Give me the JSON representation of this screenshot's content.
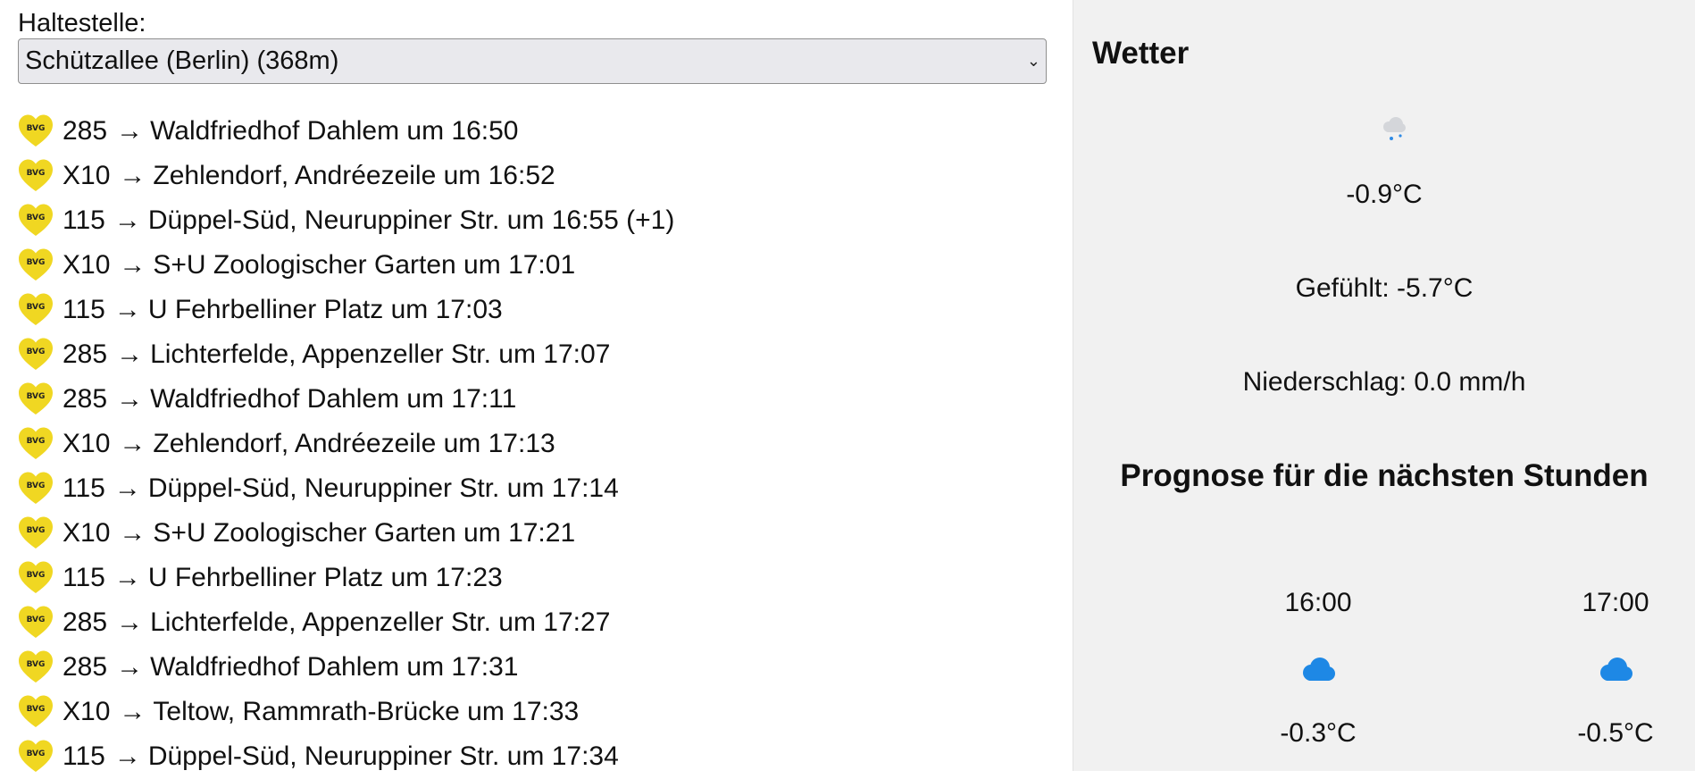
{
  "stop": {
    "label": "Haltestelle:",
    "selected": "Schützallee (Berlin) (368m)"
  },
  "departures": [
    {
      "line": "285",
      "arrow": "→",
      "text": "Waldfriedhof Dahlem um 16:50"
    },
    {
      "line": "X10",
      "arrow": "→",
      "text": "Zehlendorf, Andréezeile um 16:52"
    },
    {
      "line": "115",
      "arrow": "→",
      "text": "Düppel-Süd, Neuruppiner Str. um 16:55 (+1)"
    },
    {
      "line": "X10",
      "arrow": "→",
      "text": "S+U Zoologischer Garten um 17:01"
    },
    {
      "line": "115",
      "arrow": "→",
      "text": "U Fehrbelliner Platz um 17:03"
    },
    {
      "line": "285",
      "arrow": "→",
      "text": "Lichterfelde, Appenzeller Str. um 17:07"
    },
    {
      "line": "285",
      "arrow": "→",
      "text": "Waldfriedhof Dahlem um 17:11"
    },
    {
      "line": "X10",
      "arrow": "→",
      "text": "Zehlendorf, Andréezeile um 17:13"
    },
    {
      "line": "115",
      "arrow": "→",
      "text": "Düppel-Süd, Neuruppiner Str. um 17:14"
    },
    {
      "line": "X10",
      "arrow": "→",
      "text": "S+U Zoologischer Garten um 17:21"
    },
    {
      "line": "115",
      "arrow": "→",
      "text": "U Fehrbelliner Platz um 17:23"
    },
    {
      "line": "285",
      "arrow": "→",
      "text": "Lichterfelde, Appenzeller Str. um 17:27"
    },
    {
      "line": "285",
      "arrow": "→",
      "text": "Waldfriedhof Dahlem um 17:31"
    },
    {
      "line": "X10",
      "arrow": "→",
      "text": "Teltow, Rammrath-Brücke um 17:33"
    },
    {
      "line": "115",
      "arrow": "→",
      "text": "Düppel-Süd, Neuruppiner Str. um 17:34"
    }
  ],
  "bvg_badge": {
    "text": "BVG",
    "icon": "bvg-heart-icon",
    "color": "#f0d722"
  },
  "weather": {
    "title": "Wetter",
    "current_icon": "snow-cloud-icon",
    "temperature": "-0.9°C",
    "feels_like": "Gefühlt: -5.7°C",
    "precipitation": "Niederschlag: 0.0 mm/h",
    "forecast_title": "Prognose für die nächsten Stunden",
    "forecast": [
      {
        "time": "16:00",
        "icon": "cloud-icon",
        "temp": "-0.3°C"
      },
      {
        "time": "17:00",
        "icon": "cloud-icon",
        "temp": "-0.5°C"
      }
    ],
    "cloud_color": "#1e88e5"
  }
}
